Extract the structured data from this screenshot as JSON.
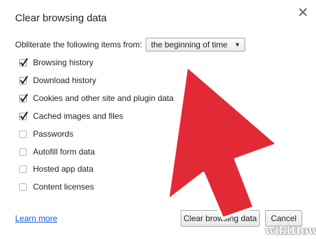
{
  "dialog": {
    "title": "Clear browsing data",
    "close_icon": "close-icon"
  },
  "range": {
    "label": "Obliterate the following items from:",
    "selected": "the beginning of time",
    "arrow": "▼"
  },
  "items": [
    {
      "label": "Browsing history",
      "checked": true
    },
    {
      "label": "Download history",
      "checked": true
    },
    {
      "label": "Cookies and other site and plugin data",
      "checked": true
    },
    {
      "label": "Cached images and files",
      "checked": true
    },
    {
      "label": "Passwords",
      "checked": false
    },
    {
      "label": "Autofill form data",
      "checked": false
    },
    {
      "label": "Hosted app data",
      "checked": false
    },
    {
      "label": "Content licenses",
      "checked": false
    }
  ],
  "footer": {
    "learn_more": "Learn more",
    "clear_button": "Clear browsing data",
    "cancel_button": "Cancel"
  },
  "overlay": {
    "arrow_color": "#e12a36",
    "arrow_outline": "#ffffff",
    "watermark": "wikiHow"
  }
}
